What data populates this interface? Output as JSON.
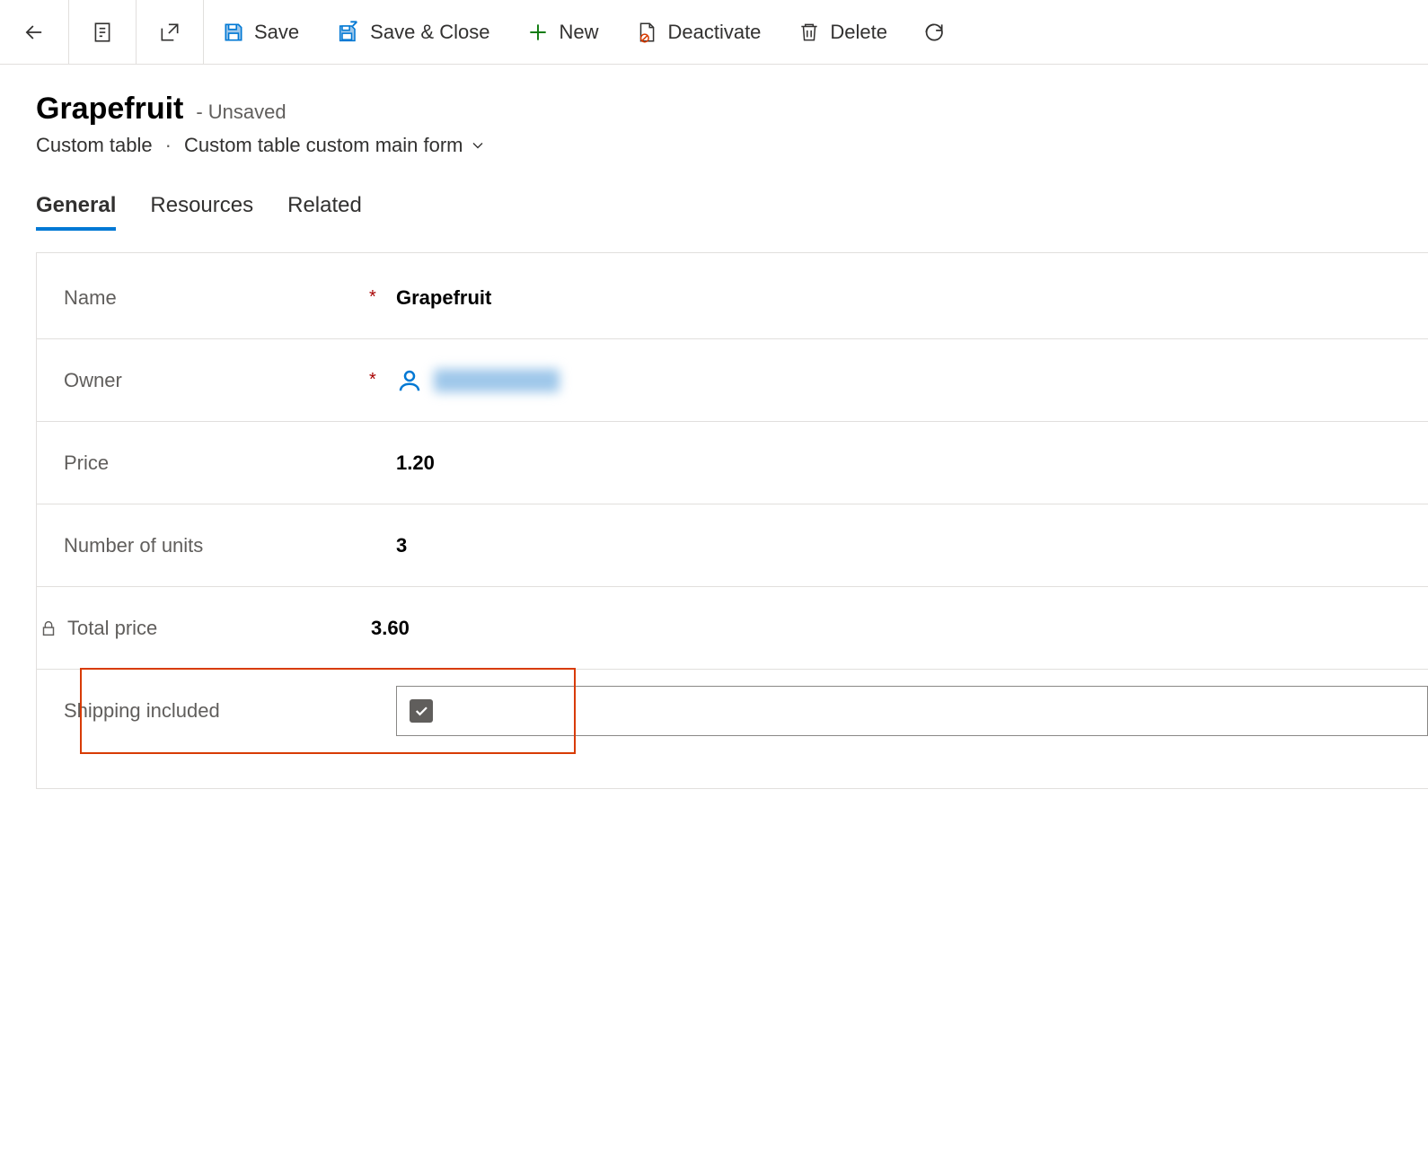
{
  "toolbar": {
    "save": "Save",
    "save_close": "Save & Close",
    "new": "New",
    "deactivate": "Deactivate",
    "delete": "Delete"
  },
  "header": {
    "title": "Grapefruit",
    "status": "- Unsaved",
    "entity": "Custom table",
    "form": "Custom table custom main form"
  },
  "tabs": {
    "general": "General",
    "resources": "Resources",
    "related": "Related"
  },
  "fields": {
    "name": {
      "label": "Name",
      "value": "Grapefruit"
    },
    "owner": {
      "label": "Owner"
    },
    "price": {
      "label": "Price",
      "value": "1.20"
    },
    "units": {
      "label": "Number of units",
      "value": "3"
    },
    "total": {
      "label": "Total price",
      "value": "3.60"
    },
    "shipping": {
      "label": "Shipping included"
    }
  }
}
